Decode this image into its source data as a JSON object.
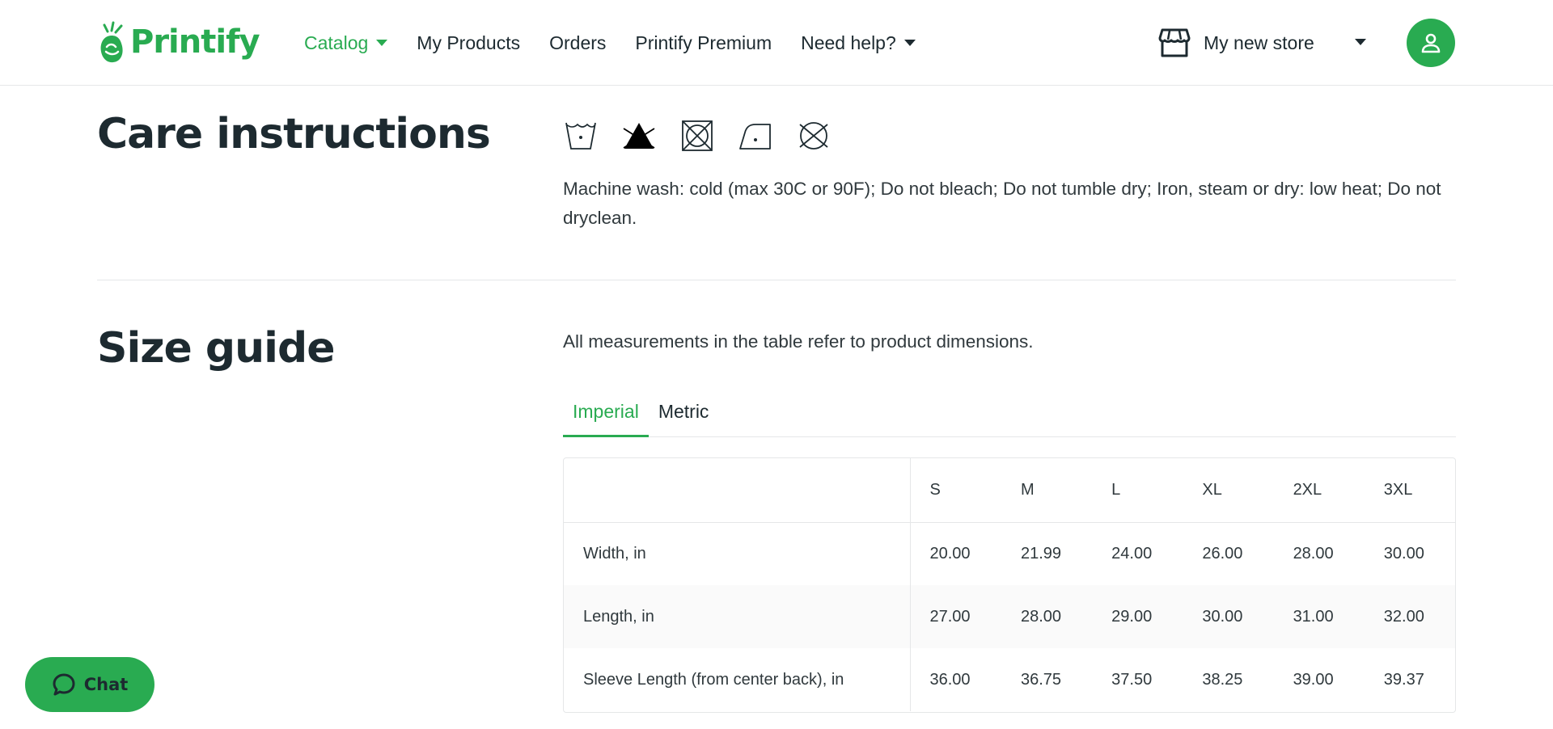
{
  "brand": {
    "name": "Printify",
    "accent": "#29ab51"
  },
  "nav": {
    "items": [
      {
        "label": "Catalog",
        "dropdown": true,
        "active": true
      },
      {
        "label": "My Products",
        "dropdown": false,
        "active": false
      },
      {
        "label": "Orders",
        "dropdown": false,
        "active": false
      },
      {
        "label": "Printify Premium",
        "dropdown": false,
        "active": false
      },
      {
        "label": "Need help?",
        "dropdown": true,
        "active": false
      }
    ]
  },
  "store": {
    "label": "My new store",
    "icon": "storefront-icon"
  },
  "user": {
    "icon": "user-icon"
  },
  "care": {
    "title": "Care instructions",
    "icons": [
      "machine-wash-cold-icon",
      "do-not-bleach-icon",
      "do-not-tumble-dry-icon",
      "iron-low-heat-icon",
      "do-not-dryclean-icon"
    ],
    "text": "Machine wash: cold (max 30C or 90F); Do not bleach; Do not tumble dry; Iron, steam or dry: low heat; Do not dryclean."
  },
  "size_guide": {
    "title": "Size guide",
    "note": "All measurements in the table refer to product dimensions.",
    "tabs": [
      {
        "label": "Imperial",
        "active": true
      },
      {
        "label": "Metric",
        "active": false
      }
    ],
    "table": {
      "headers": [
        "",
        "S",
        "M",
        "L",
        "XL",
        "2XL",
        "3XL"
      ],
      "rows": [
        {
          "label": "Width, in",
          "values": [
            "20.00",
            "21.99",
            "24.00",
            "26.00",
            "28.00",
            "30.00"
          ]
        },
        {
          "label": "Length, in",
          "values": [
            "27.00",
            "28.00",
            "29.00",
            "30.00",
            "31.00",
            "32.00"
          ]
        },
        {
          "label": "Sleeve Length (from center back), in",
          "values": [
            "36.00",
            "36.75",
            "37.50",
            "38.25",
            "39.00",
            "39.37"
          ]
        }
      ]
    }
  },
  "chat": {
    "label": "Chat"
  }
}
